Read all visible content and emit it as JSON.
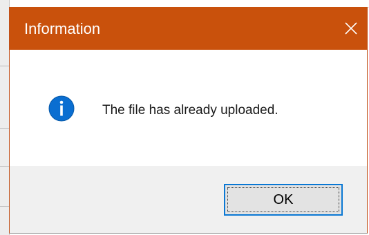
{
  "dialog": {
    "title": "Information",
    "close_icon": "close-icon",
    "message": "The file has already uploaded.",
    "icon": "info-icon",
    "ok_label": "OK"
  },
  "colors": {
    "titlebar": "#c9510c",
    "icon": "#0a6ed1",
    "button_border": "#0a78d4",
    "footer": "#f0f0f0"
  }
}
